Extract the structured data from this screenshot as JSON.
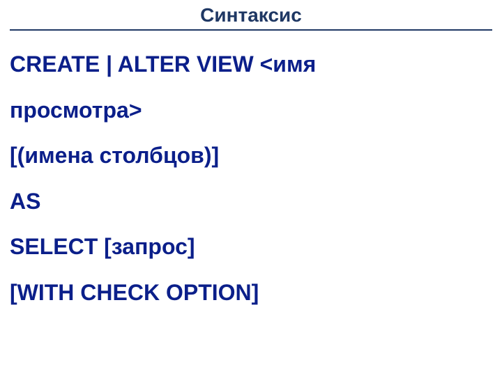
{
  "title": "Синтаксис",
  "syntax": {
    "line1_kw": "CREATE | ALTER VIEW ",
    "line1_tx": "<имя",
    "line2": "просмотра>",
    "line3": "[(имена столбцов)]",
    "line4_kw": "AS",
    "line5_kw": "SELECT ",
    "line5_tx": "[запрос]",
    "line6_open": "[",
    "line6_kw": "WITH CHECK OPTION",
    "line6_close": "]"
  }
}
